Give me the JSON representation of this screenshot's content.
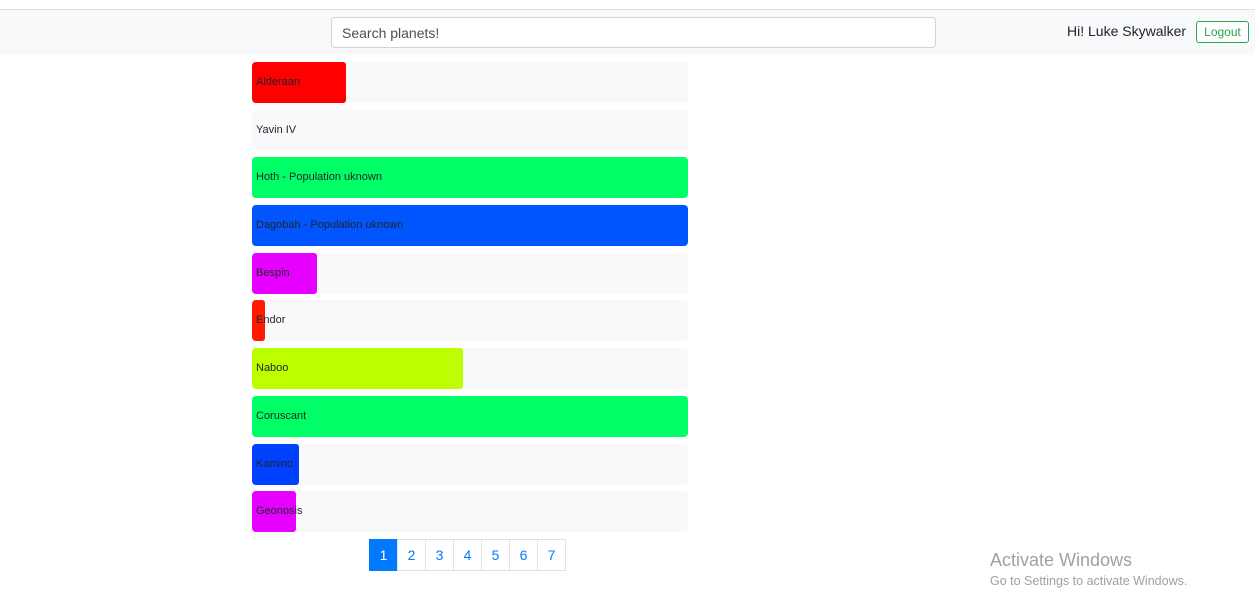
{
  "navbar": {
    "search_placeholder": "Search planets!",
    "greeting": "Hi! Luke Skywalker",
    "logout_label": "Logout",
    "logout_color": "#28a745"
  },
  "planets": [
    {
      "label": "Alderaan",
      "fill_fraction": 0.215,
      "color": "#ff0000"
    },
    {
      "label": "Yavin IV",
      "fill_fraction": 0.0,
      "color": "#f8f9fa"
    },
    {
      "label": "Hoth - Population uknown",
      "fill_fraction": 1.0,
      "color": "#00ff66"
    },
    {
      "label": "Dagobah - Population uknown",
      "fill_fraction": 1.0,
      "color": "#0055ff"
    },
    {
      "label": "Bespin",
      "fill_fraction": 0.15,
      "color": "#e600ff"
    },
    {
      "label": "Endor",
      "fill_fraction": 0.03,
      "color": "#ff1a00"
    },
    {
      "label": "Naboo",
      "fill_fraction": 0.483,
      "color": "#bbff00"
    },
    {
      "label": "Coruscant",
      "fill_fraction": 1.0,
      "color": "#00ff66"
    },
    {
      "label": "Kamino",
      "fill_fraction": 0.107,
      "color": "#0040ff"
    },
    {
      "label": "Geonosis",
      "fill_fraction": 0.1,
      "color": "#e600ff"
    }
  ],
  "pagination": {
    "pages": [
      "1",
      "2",
      "3",
      "4",
      "5",
      "6",
      "7"
    ],
    "active": "1",
    "accent": "#007bff"
  },
  "watermark": {
    "title": "Activate Windows",
    "subtitle": "Go to Settings to activate Windows."
  }
}
